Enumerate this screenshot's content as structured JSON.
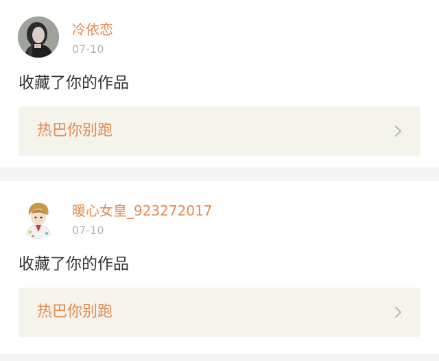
{
  "notifications": [
    {
      "username": "冷依恋",
      "time": "07-10",
      "action": "收藏了你的作品",
      "work_title": "热巴你别跑",
      "avatar_icon": "avatar-girl-dark-hair"
    },
    {
      "username": "暖心女皇_923272017",
      "time": "07-10",
      "action": "收藏了你的作品",
      "work_title": "热巴你别跑",
      "avatar_icon": "avatar-anime-boy"
    }
  ],
  "colors": {
    "accent": "#e48a50",
    "time": "#b3b3b3",
    "text": "#333333",
    "link_bg": "#f4f4ec",
    "separator": "#f4f4f4"
  }
}
